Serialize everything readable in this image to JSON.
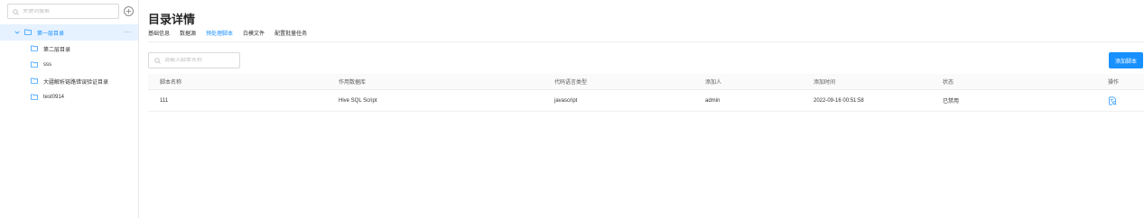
{
  "sidebar": {
    "search_placeholder": "关键词搜索",
    "root_node": {
      "label": "第一层目录",
      "more": "···"
    },
    "children": [
      {
        "label": "第二层目录"
      },
      {
        "label": "sss"
      },
      {
        "label": "大疆解析链路错误验证目录"
      },
      {
        "label": "test0914"
      }
    ]
  },
  "main": {
    "title": "目录详情",
    "tabs": [
      "基础信息",
      "数据源",
      "预处理脚本",
      "白模文件",
      "配置批量任务"
    ],
    "active_tab": 2,
    "search_placeholder": "请输入脚本名称",
    "add_button": "添加脚本",
    "table": {
      "headers": [
        "脚本名称",
        "作用数据库",
        "代码语言类型",
        "添加人",
        "添加时间",
        "状态",
        "操作"
      ],
      "rows": [
        [
          "111",
          "Hive SQL Script",
          "javascript",
          "admin",
          "2022-09-16 00:51:58",
          "已禁用"
        ]
      ]
    }
  },
  "colors": {
    "accent": "#1890ff",
    "tree_selected_bg": "#e6f2ff"
  },
  "icons": {
    "search": "search-icon",
    "add": "plus-circle-icon",
    "caret": "chevron-down-icon",
    "folder": "folder-icon",
    "action": "file-search-icon"
  }
}
